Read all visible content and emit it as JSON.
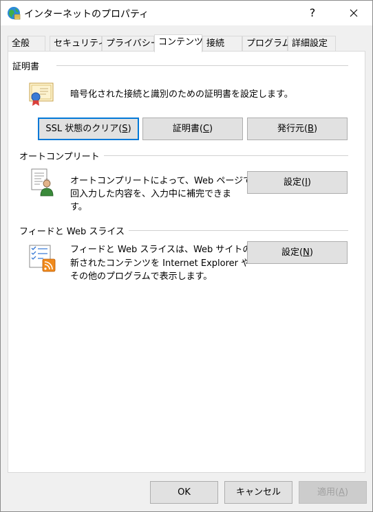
{
  "window": {
    "title": "インターネットのプロパティ",
    "help": "?",
    "close": "✕"
  },
  "tabs": [
    {
      "label": "全般"
    },
    {
      "label": "セキュリティ"
    },
    {
      "label": "プライバシー"
    },
    {
      "label": "コンテンツ"
    },
    {
      "label": "接続"
    },
    {
      "label": "プログラム"
    },
    {
      "label": "詳細設定"
    }
  ],
  "certificates": {
    "heading": "証明書",
    "description": "暗号化された接続と識別のための証明書を設定します。",
    "ssl_clear": {
      "text": "SSL 状態のクリア(",
      "key": "S",
      "suffix": ")"
    },
    "certs": {
      "text": "証明書(",
      "key": "C",
      "suffix": ")"
    },
    "publishers": {
      "text": "発行元(",
      "key": "B",
      "suffix": ")"
    }
  },
  "autocomplete": {
    "heading": "オートコンプリート",
    "line1": "オートコンプリートによって、Web ページで前",
    "line2": "回入力した内容を、入力中に補完できま",
    "line3": "す。",
    "settings": {
      "text": "設定(",
      "key": "I",
      "suffix": ")"
    }
  },
  "feeds": {
    "heading": "フィードと Web スライス",
    "line1": "フィードと Web スライスは、Web サイトの更",
    "line2": "新されたコンテンツを Internet Explorer や",
    "line3": "その他のプログラムで表示します。",
    "settings": {
      "text": "設定(",
      "key": "N",
      "suffix": ")"
    }
  },
  "footer": {
    "ok": "OK",
    "cancel": "キャンセル",
    "apply": {
      "text": "適用(",
      "key": "A",
      "suffix": ")"
    }
  }
}
